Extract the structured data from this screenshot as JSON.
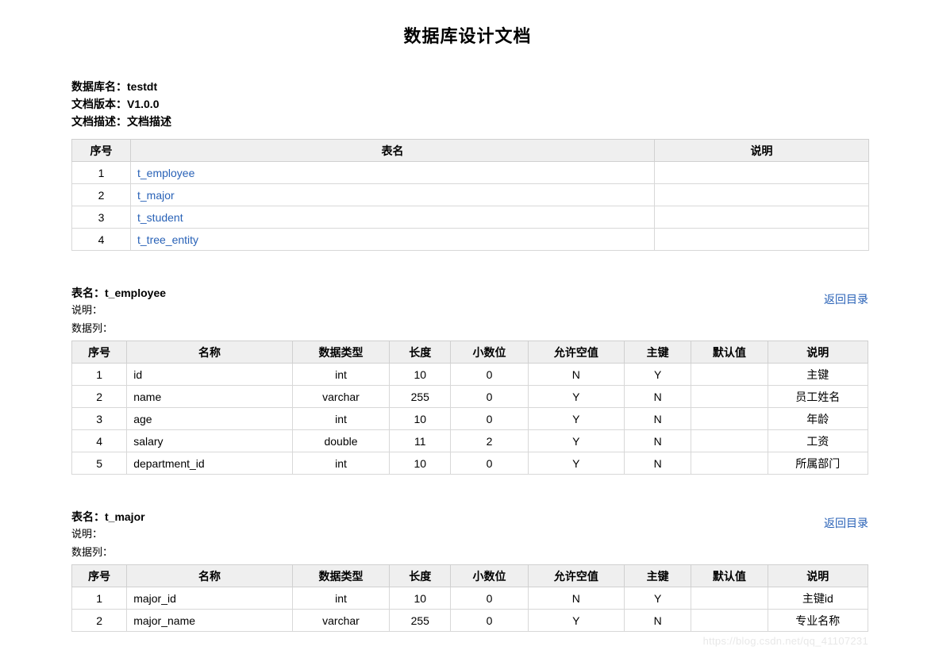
{
  "document": {
    "title": "数据库设计文档",
    "meta": [
      {
        "label": "数据库名：",
        "value": "testdt"
      },
      {
        "label": "文档版本：",
        "value": "V1.0.0"
      },
      {
        "label": "文档描述：",
        "value": "文档描述"
      }
    ]
  },
  "catalog": {
    "headers": [
      "序号",
      "表名",
      "说明"
    ],
    "rows": [
      {
        "index": "1",
        "table": "t_employee",
        "desc": ""
      },
      {
        "index": "2",
        "table": "t_major",
        "desc": ""
      },
      {
        "index": "3",
        "table": "t_student",
        "desc": ""
      },
      {
        "index": "4",
        "table": "t_tree_entity",
        "desc": ""
      }
    ]
  },
  "labels": {
    "table_name_prefix": "表名：",
    "description_label": "说明：",
    "columns_label": "数据列：",
    "back_to_catalog": "返回目录"
  },
  "detail_headers": [
    "序号",
    "名称",
    "数据类型",
    "长度",
    "小数位",
    "允许空值",
    "主键",
    "默认值",
    "说明"
  ],
  "tables": [
    {
      "name": "t_employee",
      "title": "表名：t_employee",
      "description": "",
      "rows": [
        {
          "index": "1",
          "name": "id",
          "type": "int",
          "length": "10",
          "scale": "0",
          "nullable": "N",
          "pk": "Y",
          "default": "",
          "desc": "主键"
        },
        {
          "index": "2",
          "name": "name",
          "type": "varchar",
          "length": "255",
          "scale": "0",
          "nullable": "Y",
          "pk": "N",
          "default": "",
          "desc": "员工姓名"
        },
        {
          "index": "3",
          "name": "age",
          "type": "int",
          "length": "10",
          "scale": "0",
          "nullable": "Y",
          "pk": "N",
          "default": "",
          "desc": "年龄"
        },
        {
          "index": "4",
          "name": "salary",
          "type": "double",
          "length": "11",
          "scale": "2",
          "nullable": "Y",
          "pk": "N",
          "default": "",
          "desc": "工资"
        },
        {
          "index": "5",
          "name": "department_id",
          "type": "int",
          "length": "10",
          "scale": "0",
          "nullable": "Y",
          "pk": "N",
          "default": "",
          "desc": "所属部门"
        }
      ]
    },
    {
      "name": "t_major",
      "title": "表名：t_major",
      "description": "",
      "rows": [
        {
          "index": "1",
          "name": "major_id",
          "type": "int",
          "length": "10",
          "scale": "0",
          "nullable": "N",
          "pk": "Y",
          "default": "",
          "desc": "主键id"
        },
        {
          "index": "2",
          "name": "major_name",
          "type": "varchar",
          "length": "255",
          "scale": "0",
          "nullable": "Y",
          "pk": "N",
          "default": "",
          "desc": "专业名称"
        }
      ]
    }
  ],
  "watermark": "https://blog.csdn.net/qq_41107231",
  "colors": {
    "link": "#2962b7",
    "header_bg": "#efefef",
    "border": "#d8d8d8",
    "watermark": "#e8e8e8"
  }
}
